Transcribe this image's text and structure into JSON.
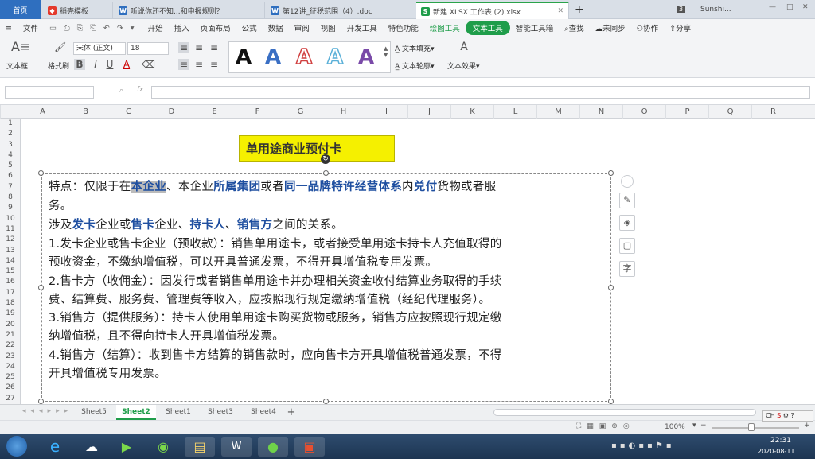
{
  "tabs": {
    "home": "首页",
    "t1": "稻壳模板",
    "t2": "听说你还不知...和申报规则？",
    "t3": "第12讲_征税范围（4）.doc",
    "t4": "新建 XLSX 工作表 (2).xlsx",
    "new_tab": "+",
    "count": "3",
    "user": "Sunshi..."
  },
  "menu": {
    "file": "文件",
    "items": [
      "开始",
      "插入",
      "页面布局",
      "公式",
      "数据",
      "审阅",
      "视图",
      "开发工具",
      "特色功能"
    ],
    "drawing_tools": "绘图工具",
    "text_tools": "文本工具",
    "smart_toolbox": "智能工具箱",
    "search": "查找",
    "unsynced": "未同步",
    "collab": "协作",
    "share": "分享"
  },
  "ribbon": {
    "textbox_label": "文本框",
    "format_painter": "格式刷",
    "font_name": "宋体 (正文)",
    "font_size": "18",
    "text_fill": "文本填充",
    "text_outline": "文本轮廓",
    "text_effects": "文本效果",
    "wordart_letter": "A",
    "bold": "B",
    "italic": "I",
    "underline": "U"
  },
  "formula": {
    "fx": "fx"
  },
  "columns": [
    "A",
    "B",
    "C",
    "D",
    "E",
    "F",
    "G",
    "H",
    "I",
    "J",
    "K",
    "L",
    "M",
    "N",
    "O",
    "P",
    "Q",
    "R"
  ],
  "rows": [
    "1",
    "2",
    "3",
    "4",
    "5",
    "6",
    "7",
    "8",
    "9",
    "10",
    "11",
    "12",
    "13",
    "14",
    "15",
    "16",
    "17",
    "18",
    "19",
    "20",
    "21",
    "22",
    "23",
    "24",
    "25",
    "26",
    "27"
  ],
  "title_box": "单用途商业预付卡",
  "body": {
    "l1": [
      "特点：仅限于在",
      "本企业",
      "、本企业",
      "所属集团",
      "或者",
      "同一品牌特许经营体系",
      "内",
      "兑付",
      "货物或者服"
    ],
    "l2": "务。",
    "l3": [
      "涉及",
      "发卡",
      "企业或",
      "售卡",
      "企业、",
      "持卡人",
      "、",
      "销售方",
      "之间的关系。"
    ],
    "l4": "1.发卡企业或售卡企业（预收款）：销售单用途卡，或者接受单用途卡持卡人充值取得的",
    "l5": "预收资金，不缴纳增值税，可以开具普通发票，不得开具增值税专用发票。",
    "l6": "2.售卡方（收佣金）：因发行或者销售单用途卡并办理相关资金收付结算业务取得的手续",
    "l7": "费、结算费、服务费、管理费等收入，应按照现行规定缴纳增值税（经纪代理服务）。",
    "l8": "3.销售方（提供服务）：持卡人使用单用途卡购买货物或服务，销售方应按照现行规定缴",
    "l9": "纳增值税，且不得向持卡人开具增值税发票。",
    "l10": "4.销售方（结算）：收到售卡方结算的销售款时，应向售卡方开具增值税普通发票，不得",
    "l11": "开具增值税专用发票。"
  },
  "sheets": [
    "Sheet5",
    "Sheet2",
    "Sheet1",
    "Sheet3",
    "Sheet4"
  ],
  "active_sheet": "Sheet2",
  "status": {
    "zoom": "100%"
  },
  "taskbar": {
    "time": "22:31",
    "date": "2020-08-11",
    "lang": "CH"
  }
}
